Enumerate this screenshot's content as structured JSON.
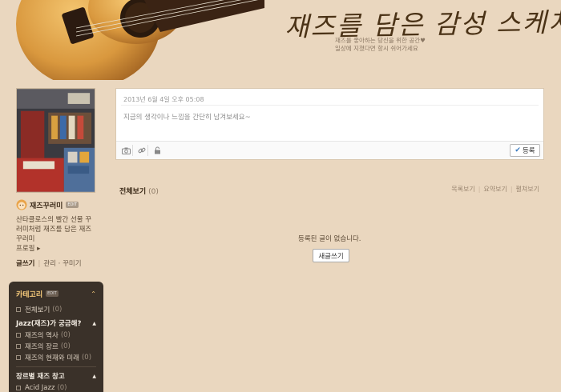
{
  "header": {
    "title": "재즈를 담은 감성 스케치",
    "subtitle_line1": "재즈를 좋아하는 당신을 위한 공간♥",
    "subtitle_line2": "일상에 지쳤다면 항시 쉬어가세요"
  },
  "profile": {
    "nickname": "재즈꾸러미",
    "edit_badge": "EDIT",
    "description": "산타클로스의 빨간 선물 꾸러미처럼 재즈를 담은 재즈꾸러미",
    "profile_link": "프로필 ▸",
    "menu": {
      "write": "글쓰기",
      "manage": "관리",
      "decorate": "꾸미기"
    }
  },
  "category": {
    "header_label": "카테고리",
    "edit_badge": "EDIT",
    "header_arrow": "⌃",
    "all": {
      "label": "전체보기",
      "count": "(0)"
    },
    "groups": [
      {
        "label": "Jazz(재즈)가 궁금해?",
        "arrow": "▲",
        "items": [
          {
            "label": "재즈의 역사",
            "count": "(0)"
          },
          {
            "label": "재즈의 장르",
            "count": "(0)"
          },
          {
            "label": "재즈의 현재와 미래",
            "count": "(0)"
          }
        ]
      },
      {
        "label": "장르별 재즈 창고",
        "arrow": "▲",
        "items": [
          {
            "label": "Acid Jazz",
            "count": "(0)"
          }
        ]
      }
    ]
  },
  "write_box": {
    "date": "2013년 6월 4일 오후 05:08",
    "placeholder": "지금의 생각이나 느낌을 간단히 남겨보세요~",
    "post_label": "등록",
    "tools": [
      "camera-icon",
      "link-icon",
      "lock-icon"
    ]
  },
  "list": {
    "title": "전체보기",
    "count": "(0)",
    "view_options": [
      "목록보기",
      "요약보기",
      "펼쳐보기"
    ],
    "empty_message": "등록된 글이 없습니다.",
    "new_post_label": "새글쓰기"
  },
  "colors": {
    "background": "#ead7bf",
    "category_bg": "#3a3129",
    "category_accent": "#f5c97a",
    "title": "#4a3216"
  }
}
